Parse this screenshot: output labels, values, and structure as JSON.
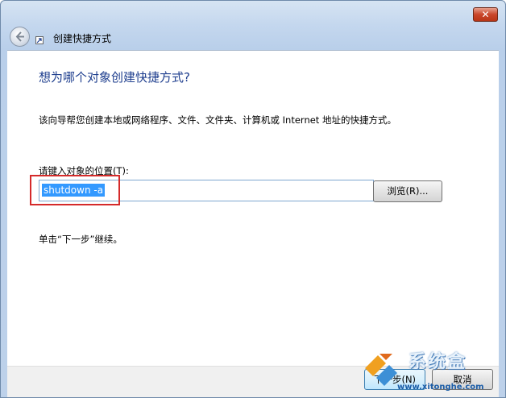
{
  "window": {
    "title": "创建快捷方式",
    "close_label": "✕"
  },
  "wizard": {
    "heading": "想为哪个对象创建快捷方式?",
    "description": "该向导帮您创建本地或网络程序、文件、文件夹、计算机或 Internet 地址的快捷方式。",
    "location_label": "请键入对象的位置(T):",
    "location_value": "shutdown -a",
    "browse_label": "浏览(R)...",
    "hint": "单击“下一步”继续。"
  },
  "footer": {
    "next_label": "下一步(N)",
    "cancel_label": "取消"
  },
  "watermark": {
    "brand": "系统盒",
    "url": "www.xitonghe.com"
  },
  "colors": {
    "heading": "#1e3e8e",
    "highlight_box": "#d52a2a",
    "selection": "#3399ff"
  },
  "icons": [
    "back-arrow-icon",
    "shortcut-arrow-icon",
    "close-icon",
    "watermark-logo-icon"
  ]
}
